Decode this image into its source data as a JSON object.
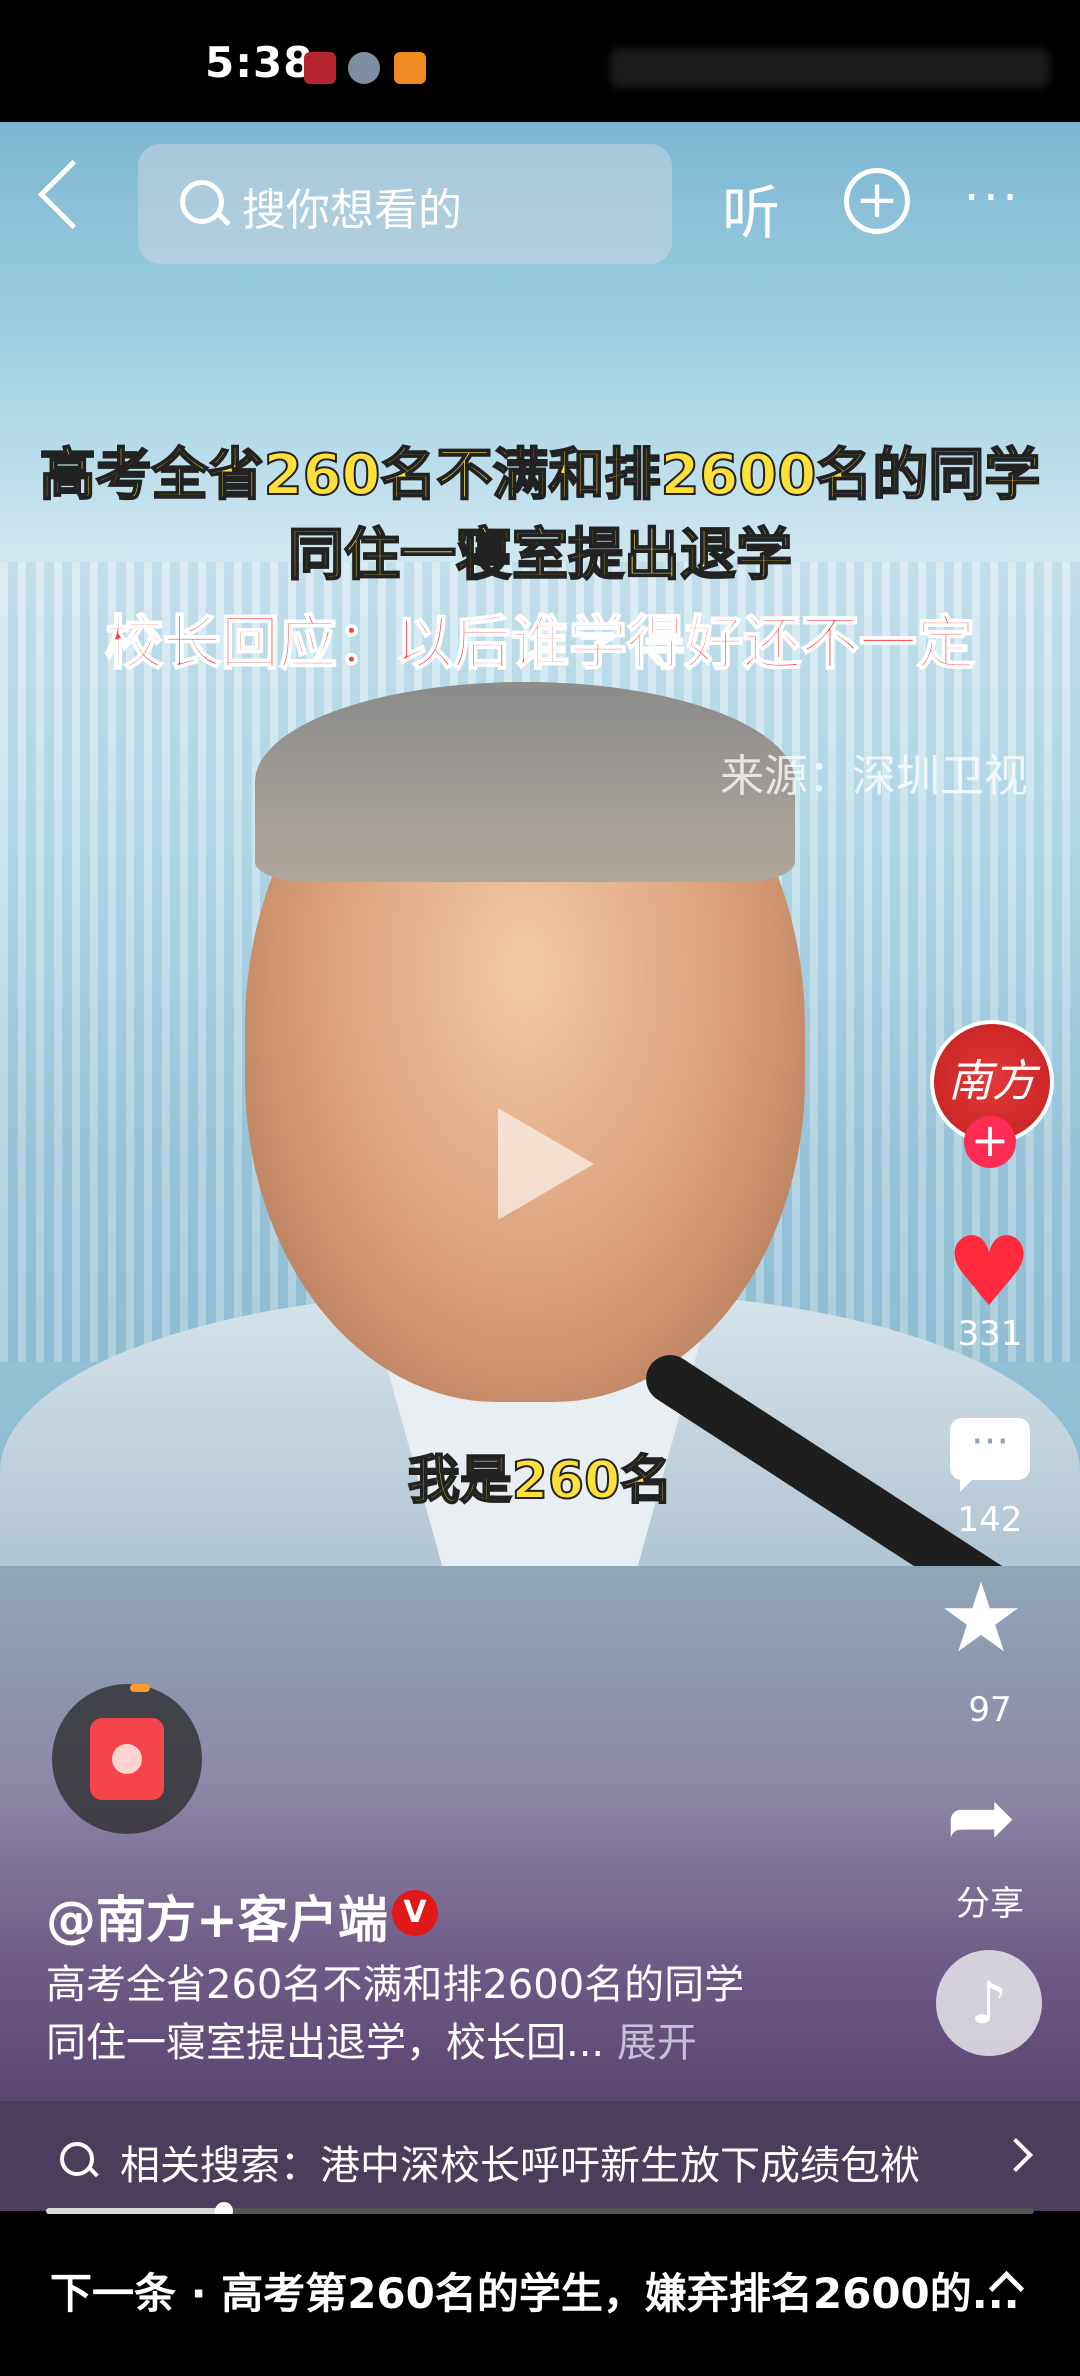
{
  "status_bar": {
    "time": "5:38"
  },
  "top_bar": {
    "search_placeholder": "搜你想看的",
    "listen_label": "听",
    "add_symbol": "+",
    "more_symbol": "···"
  },
  "video": {
    "headline_line1": "高考全省260名不满和排2600名的同学",
    "headline_line2": "同住一寝室提出退学",
    "headline_line3": "校长回应：以后谁学得好还不一定",
    "source": "来源：深圳卫视",
    "subtitle": "我是260名"
  },
  "right_rail": {
    "avatar_text": "南方",
    "likes": "331",
    "comments": "142",
    "favorites": "97",
    "share_label": "分享"
  },
  "post": {
    "author": "@南方+客户端",
    "verified_mark": "V",
    "desc_line1": "高考全省260名不满和排2600名的同学",
    "desc_line2": "同住一寝室提出退学，校长回...",
    "expand_label": "展开"
  },
  "related_search": {
    "text": "相关搜索：港中深校长呼吁新生放下成绩包袱"
  },
  "playback": {
    "progress": 0.18
  },
  "next_bar": {
    "text": "下一条 · 高考第260名的学生，嫌弃排名2600的..."
  },
  "colors": {
    "like_red": "#ff2b3d",
    "verified_red": "#e01818",
    "headline_yellow": "#ffe03a",
    "headline_red": "#ff3a3a"
  }
}
